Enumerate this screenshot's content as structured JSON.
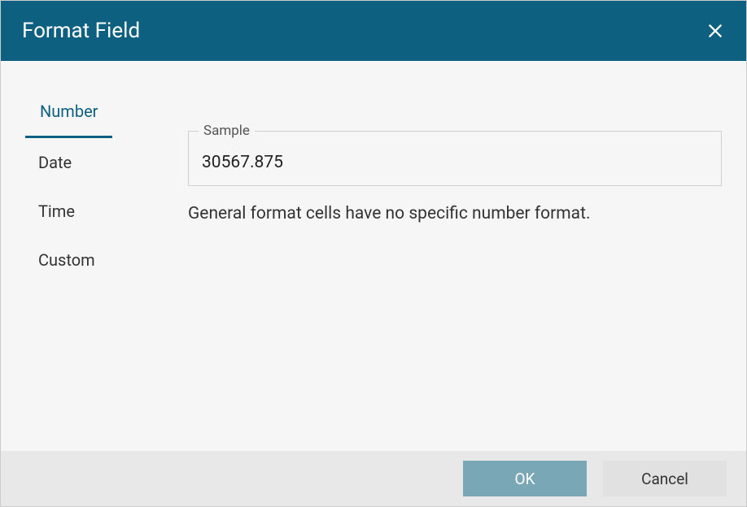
{
  "dialog": {
    "title": "Format Field"
  },
  "tabs": [
    {
      "label": "Number",
      "active": true
    },
    {
      "label": "Date",
      "active": false
    },
    {
      "label": "Time",
      "active": false
    },
    {
      "label": "Custom",
      "active": false
    }
  ],
  "sample": {
    "legend": "Sample",
    "value": "30567.875"
  },
  "description": "General format cells have no specific number format.",
  "buttons": {
    "ok": "OK",
    "cancel": "Cancel"
  }
}
